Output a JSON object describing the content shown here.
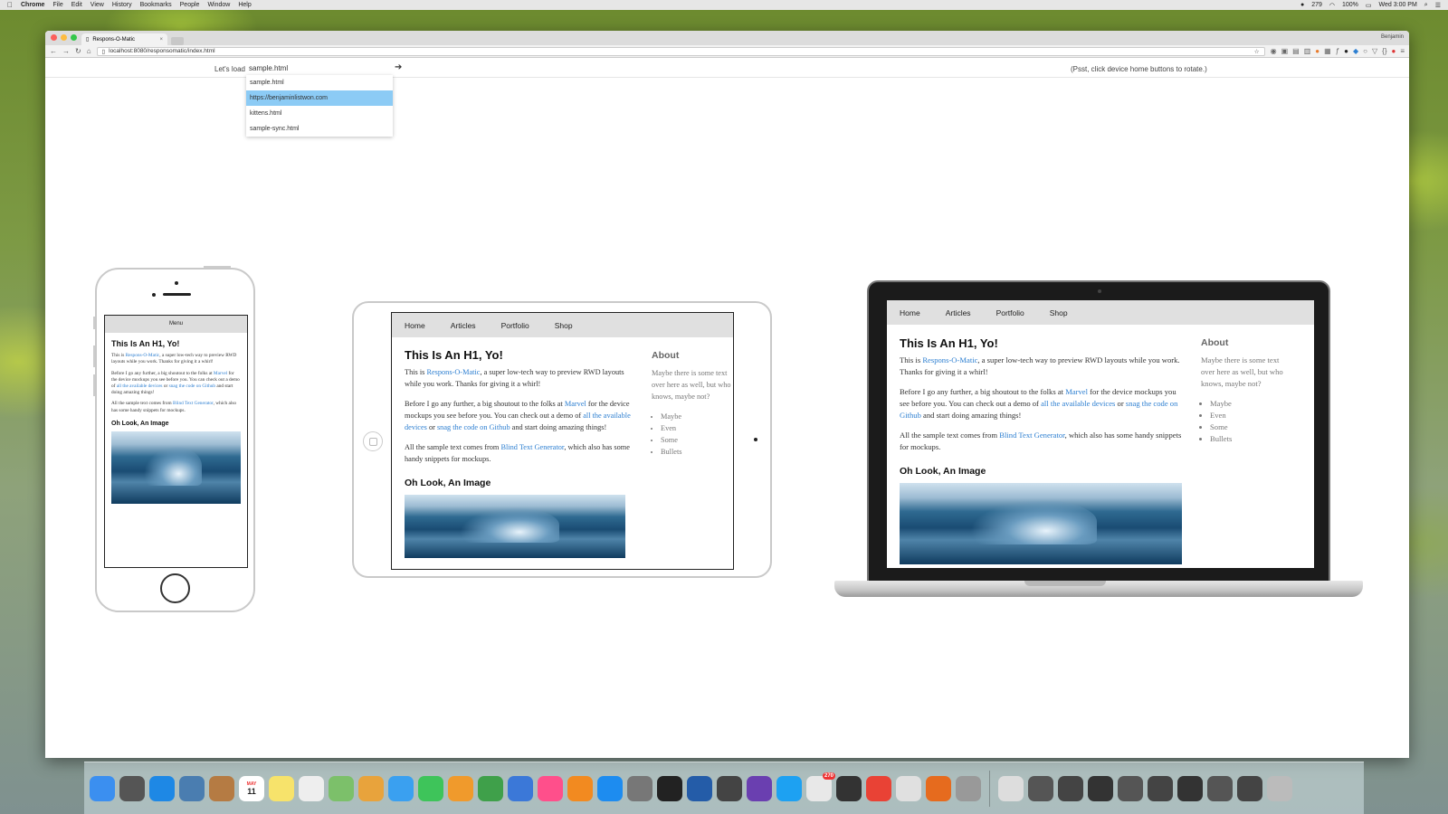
{
  "menubar": {
    "apple": "",
    "app": "Chrome",
    "items": [
      "File",
      "Edit",
      "View",
      "History",
      "Bookmarks",
      "People",
      "Window",
      "Help"
    ],
    "status_count": "279",
    "battery": "100%",
    "clock": "Wed 3:00 PM"
  },
  "browser": {
    "tab_title": "Respons-O-Matic",
    "profile": "Benjamin",
    "url": "localhost:8080/responsomatic/index.html"
  },
  "loader": {
    "label": "Let's load",
    "value": "sample.html",
    "psst": "(Psst, click device home buttons to rotate.)",
    "options": [
      "sample.html",
      "https://benjaminlistwon.com",
      "kittens.html",
      "sample-sync.html"
    ],
    "selected_index": 1
  },
  "phone_page": {
    "menu": "Menu",
    "h1": "This Is An H1, Yo!",
    "p1_pre": "This is ",
    "p1_link": "Respons-O-Matic",
    "p1_post": ", a super low-tech way to preview RWD layouts while you work. Thanks for giving it a whirl!",
    "p2_pre": "Before I go any further, a big shoutout to the folks at ",
    "p2_link1": "Marvel",
    "p2_mid": " for the device mockups you see before you. You can check out a demo of ",
    "p2_link2": "all the available devices",
    "p2_or": " or ",
    "p2_link3": "snag the code on Github",
    "p2_post": " and start doing amazing things!",
    "p3_pre": "All the sample text comes from ",
    "p3_link": "Blind Text Generator",
    "p3_post": ", which also has some handy snippets for mockups.",
    "h2": "Oh Look, An Image"
  },
  "site": {
    "nav": [
      "Home",
      "Articles",
      "Portfolio",
      "Shop"
    ],
    "about_title": "About",
    "about_text": "Maybe there is some text over here as well, but who knows, maybe not?",
    "bullets": [
      "Maybe",
      "Even",
      "Some",
      "Bullets"
    ]
  },
  "dock": {
    "apps": [
      "finder",
      "launchpad",
      "safari",
      "preview",
      "contacts",
      "calendar",
      "notes",
      "reminders",
      "maps",
      "photos",
      "messages",
      "facetime",
      "pages",
      "numbers",
      "keynote",
      "itunes",
      "ibooks",
      "app-store",
      "system-preferences",
      "terminal",
      "1password",
      "sublime",
      "dash",
      "twitter",
      "notification",
      "github",
      "chrome",
      "slack",
      "firefox",
      "utility",
      "folder",
      "stack-1",
      "stack-2",
      "stack-3",
      "stack-4",
      "stack-5",
      "stack-6",
      "stack-7",
      "stack-8",
      "trash"
    ],
    "calendar_month": "MAY",
    "calendar_day": "11",
    "badge": "270"
  }
}
